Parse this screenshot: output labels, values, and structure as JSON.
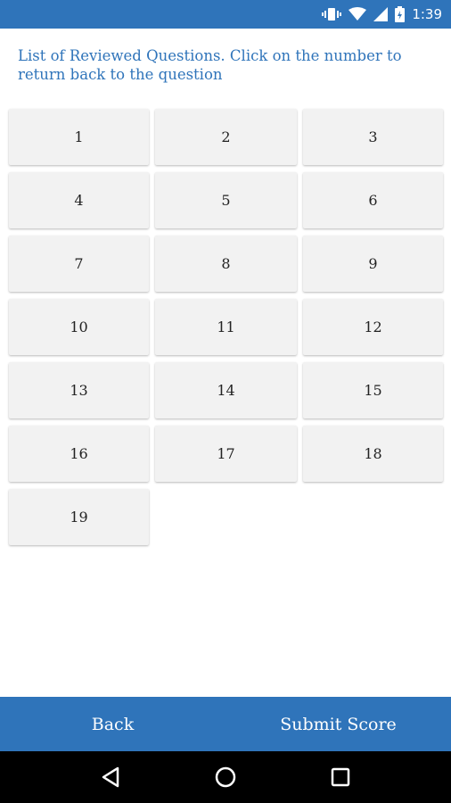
{
  "status_bar": {
    "time": "1:39",
    "icons": [
      "vibrate-icon",
      "wifi-icon",
      "signal-icon",
      "battery-icon"
    ]
  },
  "instructions": "List of Reviewed Questions. Click on the number to return back to the question",
  "questions": [
    "1",
    "2",
    "3",
    "4",
    "5",
    "6",
    "7",
    "8",
    "9",
    "10",
    "11",
    "12",
    "13",
    "14",
    "15",
    "16",
    "17",
    "18",
    "19"
  ],
  "bottom_bar": {
    "back_label": "Back",
    "submit_label": "Submit Score"
  },
  "nav_bar": {
    "icons": [
      "back-triangle-icon",
      "home-circle-icon",
      "recents-square-icon"
    ]
  },
  "colors": {
    "primary": "#2f74ba",
    "button_bg": "#f2f2f2"
  }
}
